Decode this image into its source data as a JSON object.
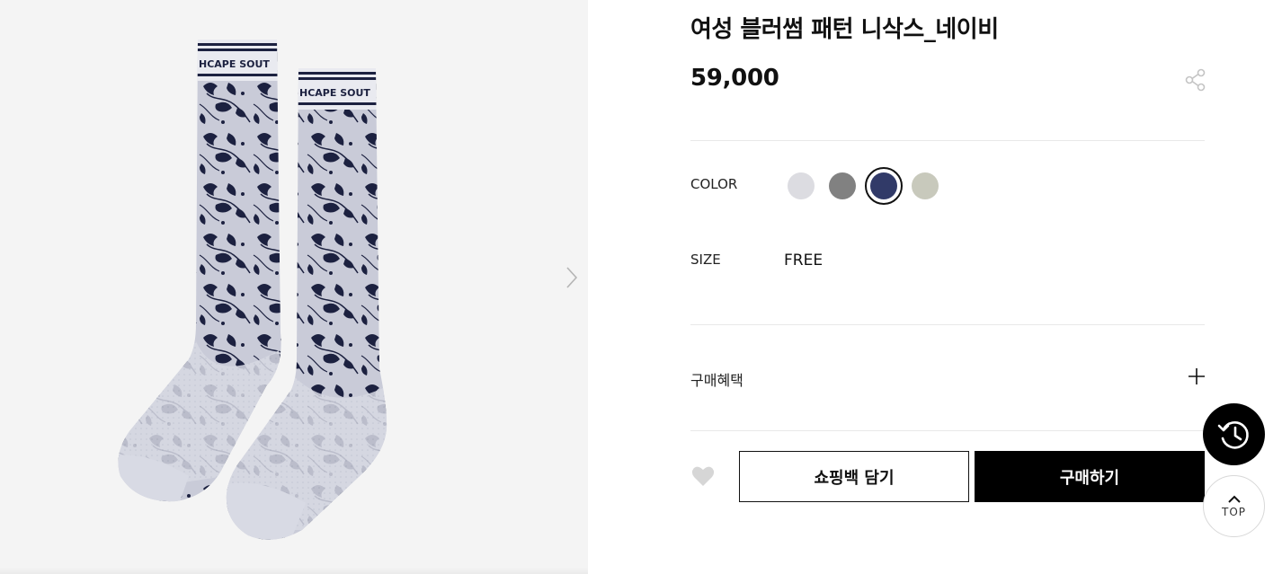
{
  "gallery": {
    "image_alt": "product-socks-photo",
    "sock_band_text_left": "HCAPE SOUT",
    "sock_band_text_right": "HCAPE SOUT",
    "next_icon": "chevron-right-icon"
  },
  "product": {
    "title": "여성 블러썸 패턴 니삭스_네이비",
    "price": "59,000",
    "share_icon": "share-icon"
  },
  "options": {
    "color_label": "COLOR",
    "colors": [
      {
        "hex": "#dcdce1",
        "selected": false
      },
      {
        "hex": "#818181",
        "selected": false
      },
      {
        "hex": "#313a68",
        "selected": true
      },
      {
        "hex": "#c8c9bc",
        "selected": false
      }
    ],
    "size_label": "SIZE",
    "size_value": "FREE"
  },
  "benefit": {
    "label": "구매혜택",
    "toggle_icon": "plus-icon"
  },
  "actions": {
    "wishlist_icon": "heart-icon",
    "cart_label": "쇼핑백 담기",
    "buy_label": "구매하기"
  },
  "floating": {
    "recent_icon": "history-clock-icon",
    "top_label": "TOP",
    "top_icon": "chevron-up-icon"
  },
  "colors": {
    "primary": "#000000",
    "divider": "#e8e8e8",
    "gallery_bg": "#f4f4f4"
  }
}
